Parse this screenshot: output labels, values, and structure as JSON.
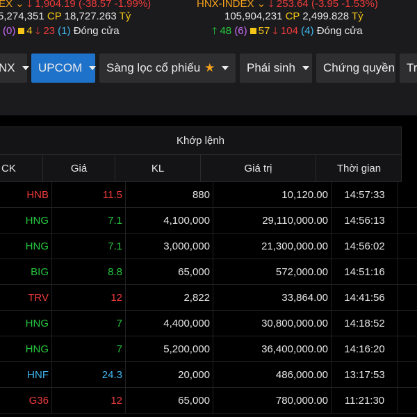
{
  "index_bar": {
    "left": {
      "name_fragment": "EX",
      "value": "1,904.19",
      "change": "(-38.57 -1.99%)",
      "volume": "274,351",
      "cp_label": "CP",
      "amount": "18,727.263",
      "unit": "Tỷ",
      "ceiling_count": "(0)",
      "unchanged_count": "4",
      "down_count": "23",
      "floor_count": "(1)",
      "status": "Đóng cửa"
    },
    "right": {
      "name": "HNX-INDEX",
      "value": "253.64",
      "change": "(-3.95 -1.53%)",
      "volume": "105,904,231",
      "cp_label": "CP",
      "amount": "2,499.828",
      "unit": "Tỷ",
      "up_count": "48",
      "ceiling_count": "(6)",
      "unchanged_count": "57",
      "down_count": "104",
      "floor_count": "(4)",
      "status": "Đóng cửa"
    }
  },
  "tabs": [
    {
      "label": "NX",
      "active": false
    },
    {
      "label": "UPCOM",
      "active": true
    },
    {
      "label": "Sàng lọc cổ phiếu",
      "active": false
    },
    {
      "label": "Phái sinh",
      "active": false
    },
    {
      "label": "Chứng quyền",
      "active": false
    },
    {
      "label": "Trá",
      "active": false
    }
  ],
  "table": {
    "group_header": "Khớp lệnh",
    "columns": [
      "CK",
      "Giá",
      "KL",
      "Giá trị",
      "Thời gian"
    ],
    "rows": [
      {
        "ck": "HNB",
        "gia": "11.5",
        "kl": "880",
        "gt": "10,120.00",
        "tg": "14:57:33",
        "color": "#f23b3b"
      },
      {
        "ck": "HNG",
        "gia": "7.1",
        "kl": "4,100,000",
        "gt": "29,110,000.00",
        "tg": "14:56:13",
        "color": "#27c93f"
      },
      {
        "ck": "HNG",
        "gia": "7.1",
        "kl": "3,000,000",
        "gt": "21,300,000.00",
        "tg": "14:56:02",
        "color": "#27c93f"
      },
      {
        "ck": "BIG",
        "gia": "8.8",
        "kl": "65,000",
        "gt": "572,000.00",
        "tg": "14:51:16",
        "color": "#27c93f"
      },
      {
        "ck": "TRV",
        "gia": "12",
        "kl": "2,822",
        "gt": "33,864.00",
        "tg": "14:41:56",
        "color": "#f23b3b"
      },
      {
        "ck": "HNG",
        "gia": "7",
        "kl": "4,400,000",
        "gt": "30,800,000.00",
        "tg": "14:18:52",
        "color": "#27c93f"
      },
      {
        "ck": "HNG",
        "gia": "7",
        "kl": "5,200,000",
        "gt": "36,400,000.00",
        "tg": "14:16:20",
        "color": "#27c93f"
      },
      {
        "ck": "HNF",
        "gia": "24.3",
        "kl": "20,000",
        "gt": "486,000.00",
        "tg": "13:17:53",
        "color": "#3fb7f0"
      },
      {
        "ck": "G36",
        "gia": "12",
        "kl": "65,000",
        "gt": "780,000.00",
        "tg": "11:21:30",
        "color": "#f23b3b"
      }
    ]
  }
}
